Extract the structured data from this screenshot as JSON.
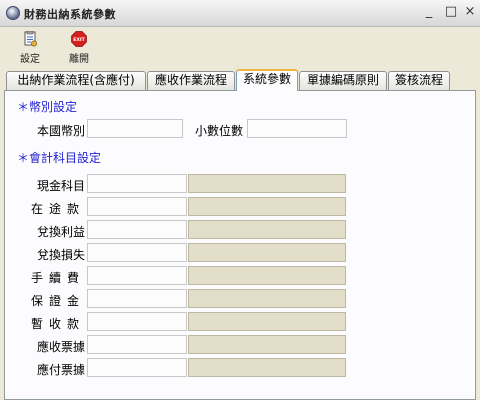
{
  "window": {
    "title": "財務出納系統參數",
    "minimize": "_",
    "maximize": "□",
    "close": "×"
  },
  "toolbar": {
    "settings_label": "設定",
    "exit_label": "離開",
    "exit_icon_text": "EXIT"
  },
  "tabs": [
    {
      "label": "出納作業流程(含應付)",
      "active": false
    },
    {
      "label": "應收作業流程",
      "active": false
    },
    {
      "label": "系統參數",
      "active": true
    },
    {
      "label": "單據編碼原則",
      "active": false
    },
    {
      "label": "簽核流程",
      "active": false
    }
  ],
  "currency_section": {
    "title": "＊幣別設定",
    "base_currency_label": "本國幣別",
    "base_currency_value": "",
    "decimal_label": "小數位數",
    "decimal_value": ""
  },
  "account_section": {
    "title": "＊會計科目設定",
    "rows": [
      {
        "label": "現金科目",
        "code": "",
        "name": ""
      },
      {
        "label": "在途款",
        "code": "",
        "name": ""
      },
      {
        "label": "兌換利益",
        "code": "",
        "name": ""
      },
      {
        "label": "兌換損失",
        "code": "",
        "name": ""
      },
      {
        "label": "手續費",
        "code": "",
        "name": ""
      },
      {
        "label": "保證金",
        "code": "",
        "name": ""
      },
      {
        "label": "暫收款",
        "code": "",
        "name": ""
      },
      {
        "label": "應收票據",
        "code": "",
        "name": ""
      },
      {
        "label": "應付票據",
        "code": "",
        "name": ""
      }
    ]
  },
  "colors": {
    "section_title": "#1f1fcf",
    "readonly_field": "#e2dec8",
    "active_tab_accent": "#f3b53a"
  }
}
